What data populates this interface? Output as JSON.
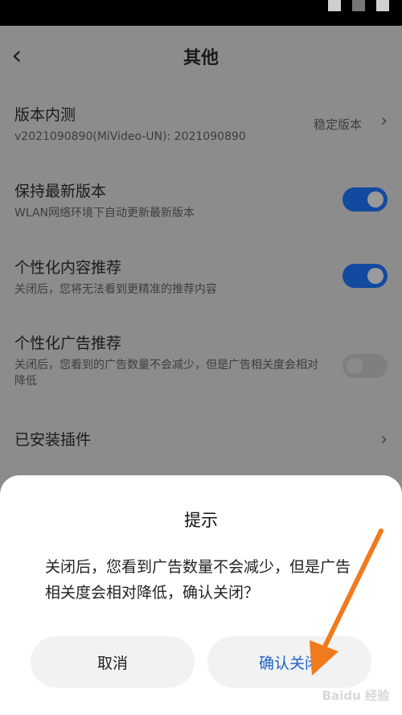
{
  "header": {
    "title": "其他"
  },
  "settings": [
    {
      "label": "版本内测",
      "sub": "v2021090890(MiVideo-UN): 2021090890",
      "value": "稳定版本",
      "control": "chevron"
    },
    {
      "label": "保持最新版本",
      "sub": "WLAN网络环境下自动更新最新版本",
      "control": "toggle",
      "state": "on"
    },
    {
      "label": "个性化内容推荐",
      "sub": "关闭后，您将无法看到更精准的推荐内容",
      "control": "toggle",
      "state": "on"
    },
    {
      "label": "个性化广告推荐",
      "sub": "关闭后，您看到的广告数量不会减少，但是广告相关度会相对降低",
      "control": "toggle",
      "state": "off"
    },
    {
      "label": "已安装插件",
      "control": "chevron"
    }
  ],
  "dialog": {
    "title": "提示",
    "message": "关闭后，您看到广告数量不会减少，但是广告相关度会相对降低，确认关闭？",
    "cancel_label": "取消",
    "confirm_label": "确认关闭"
  },
  "colors": {
    "accent": "#1f63c7",
    "toggle_on": "#124aa0",
    "arrow": "#f07a1c"
  },
  "icons": [
    "back-arrow-icon",
    "chevron-right-icon",
    "annotation-arrow-icon"
  ],
  "watermark": "Baidu 经验"
}
